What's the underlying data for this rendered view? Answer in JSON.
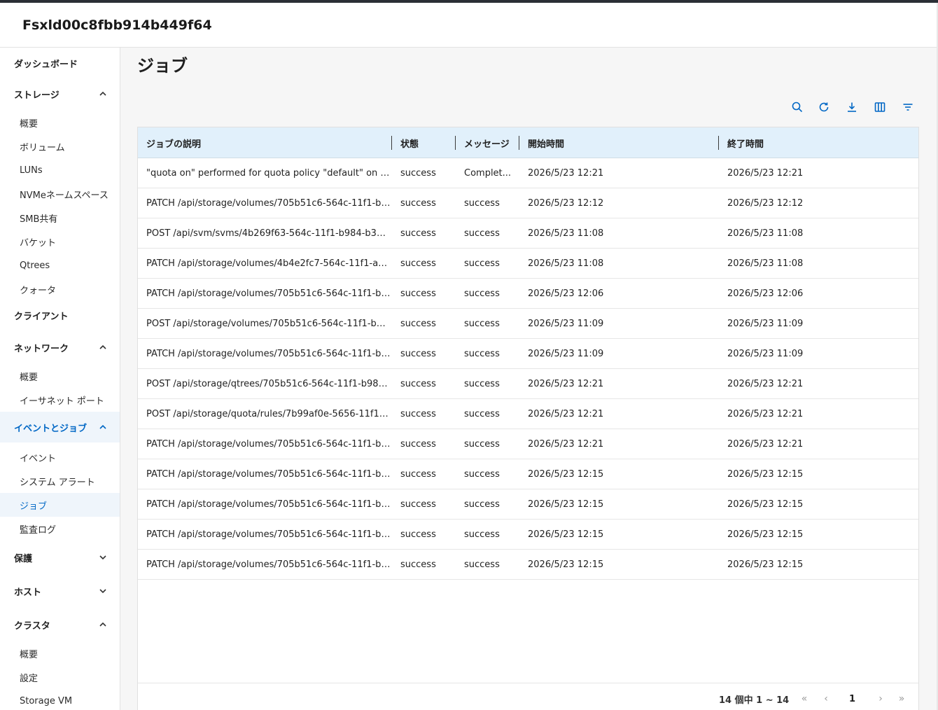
{
  "app": {
    "title": "Fsxld00c8fbb914b449f64"
  },
  "sidebar": {
    "items": [
      {
        "label": "ダッシュボード",
        "kind": "group"
      },
      {
        "label": "ストレージ",
        "kind": "group",
        "expanded": true
      },
      {
        "label": "概要",
        "kind": "sub"
      },
      {
        "label": "ボリューム",
        "kind": "sub"
      },
      {
        "label": "LUNs",
        "kind": "sub"
      },
      {
        "label": "NVMeネームスペース",
        "kind": "sub"
      },
      {
        "label": "SMB共有",
        "kind": "sub"
      },
      {
        "label": "バケット",
        "kind": "sub"
      },
      {
        "label": "Qtrees",
        "kind": "sub"
      },
      {
        "label": "クォータ",
        "kind": "sub"
      },
      {
        "label": "クライアント",
        "kind": "group"
      },
      {
        "label": "ネットワーク",
        "kind": "group",
        "expanded": true
      },
      {
        "label": "概要",
        "kind": "sub"
      },
      {
        "label": "イーサネット ポート",
        "kind": "sub"
      },
      {
        "label": "イベントとジョブ",
        "kind": "group",
        "expanded": true,
        "active": true
      },
      {
        "label": "イベント",
        "kind": "sub"
      },
      {
        "label": "システム アラート",
        "kind": "sub"
      },
      {
        "label": "ジョブ",
        "kind": "sub",
        "active": true
      },
      {
        "label": "監査ログ",
        "kind": "sub"
      },
      {
        "label": "保護",
        "kind": "group",
        "expanded": false
      },
      {
        "label": "ホスト",
        "kind": "group",
        "expanded": false
      },
      {
        "label": "クラスタ",
        "kind": "group",
        "expanded": true
      },
      {
        "label": "概要",
        "kind": "sub"
      },
      {
        "label": "設定",
        "kind": "sub"
      },
      {
        "label": "Storage VM",
        "kind": "sub"
      }
    ]
  },
  "main": {
    "title": "ジョブ",
    "toolbar": [
      "search-icon",
      "refresh-icon",
      "download-icon",
      "columns-icon",
      "filter-icon"
    ],
    "accent": "#0067c5",
    "table": {
      "headers": [
        "ジョブの説明",
        "状態",
        "メッセージ",
        "開始時間",
        "終了時間"
      ],
      "rows": [
        [
          "\"quota on\" performed for quota policy \"default\" on vo...",
          "success",
          "Complet...",
          "2026/5/23 12:21",
          "2026/5/23 12:21"
        ],
        [
          "PATCH /api/storage/volumes/705b51c6-564c-11f1-b9...",
          "success",
          "success",
          "2026/5/23 12:12",
          "2026/5/23 12:12"
        ],
        [
          "POST /api/svm/svms/4b269f63-564c-11f1-b984-b37f...",
          "success",
          "success",
          "2026/5/23 11:08",
          "2026/5/23 11:08"
        ],
        [
          "PATCH /api/storage/volumes/4b4e2fc7-564c-11f1-ad1...",
          "success",
          "success",
          "2026/5/23 11:08",
          "2026/5/23 11:08"
        ],
        [
          "PATCH /api/storage/volumes/705b51c6-564c-11f1-b9...",
          "success",
          "success",
          "2026/5/23 12:06",
          "2026/5/23 12:06"
        ],
        [
          "POST /api/storage/volumes/705b51c6-564c-11f1-b98...",
          "success",
          "success",
          "2026/5/23 11:09",
          "2026/5/23 11:09"
        ],
        [
          "PATCH /api/storage/volumes/705b51c6-564c-11f1-b9...",
          "success",
          "success",
          "2026/5/23 11:09",
          "2026/5/23 11:09"
        ],
        [
          "POST /api/storage/qtrees/705b51c6-564c-11f1-b984-...",
          "success",
          "success",
          "2026/5/23 12:21",
          "2026/5/23 12:21"
        ],
        [
          "POST /api/storage/quota/rules/7b99af0e-5656-11f1-b...",
          "success",
          "success",
          "2026/5/23 12:21",
          "2026/5/23 12:21"
        ],
        [
          "PATCH /api/storage/volumes/705b51c6-564c-11f1-b9...",
          "success",
          "success",
          "2026/5/23 12:21",
          "2026/5/23 12:21"
        ],
        [
          "PATCH /api/storage/volumes/705b51c6-564c-11f1-b9...",
          "success",
          "success",
          "2026/5/23 12:15",
          "2026/5/23 12:15"
        ],
        [
          "PATCH /api/storage/volumes/705b51c6-564c-11f1-b9...",
          "success",
          "success",
          "2026/5/23 12:15",
          "2026/5/23 12:15"
        ],
        [
          "PATCH /api/storage/volumes/705b51c6-564c-11f1-b9...",
          "success",
          "success",
          "2026/5/23 12:15",
          "2026/5/23 12:15"
        ],
        [
          "PATCH /api/storage/volumes/705b51c6-564c-11f1-b9...",
          "success",
          "success",
          "2026/5/23 12:15",
          "2026/5/23 12:15"
        ]
      ]
    },
    "pagination": {
      "summary": "14 個中 1 ~ 14",
      "current_page": "1",
      "first": "«",
      "prev": "‹",
      "next": "›",
      "last": "»"
    }
  }
}
